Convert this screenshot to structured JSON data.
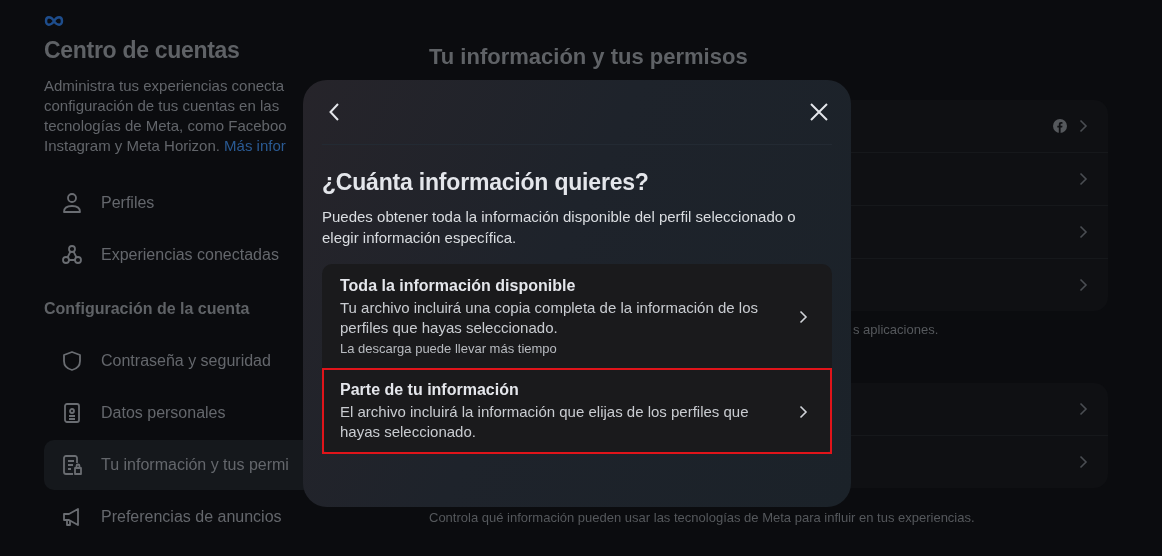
{
  "sidebar": {
    "title": "Centro de cuentas",
    "description_lines": [
      "Administra tus experiencias conecta",
      "configuración de tus cuentas en las",
      "tecnologías de Meta, como Faceboo",
      "Instagram y Meta Horizon. "
    ],
    "description_link": "Más infor",
    "sections": [
      {
        "items": [
          {
            "kind": "person",
            "label": "Perfiles",
            "selected": false
          },
          {
            "kind": "nodes",
            "label": "Experiencias conectadas",
            "selected": false
          }
        ]
      },
      {
        "heading": "Configuración de la cuenta",
        "items": [
          {
            "kind": "shield",
            "label": "Contraseña y seguridad",
            "selected": false
          },
          {
            "kind": "idcard",
            "label": "Datos personales",
            "selected": false
          },
          {
            "kind": "doclock",
            "label": "Tu información y tus permi",
            "selected": true
          },
          {
            "kind": "megaphone",
            "label": "Preferencias de anuncios",
            "selected": false
          }
        ]
      }
    ]
  },
  "main": {
    "title": "Tu información y tus permisos",
    "cards": [
      {
        "rows": [
          {
            "kind": "facebook"
          },
          {
            "kind": "plain"
          },
          {
            "kind": "plain"
          },
          {
            "kind": "plain"
          }
        ],
        "note": "s aplicaciones."
      },
      {
        "rows": [
          {
            "kind": "plain"
          },
          {
            "kind": "plain"
          }
        ],
        "note": "Controla qué información pueden usar las tecnologías de Meta para influir en tus experiencias."
      }
    ]
  },
  "modal": {
    "title": "¿Cuánta información quieres?",
    "description": "Puedes obtener toda la información disponible del perfil seleccionado o elegir información específica.",
    "options": [
      {
        "title": "Toda la información disponible",
        "description": "Tu archivo incluirá una copia completa de la información de los perfiles que hayas seleccionado.",
        "note": "La descarga puede llevar más tiempo",
        "highlighted": false
      },
      {
        "title": "Parte de tu información",
        "description": "El archivo incluirá la información que elijas de los perfiles que hayas seleccionado.",
        "highlighted": true
      }
    ]
  }
}
